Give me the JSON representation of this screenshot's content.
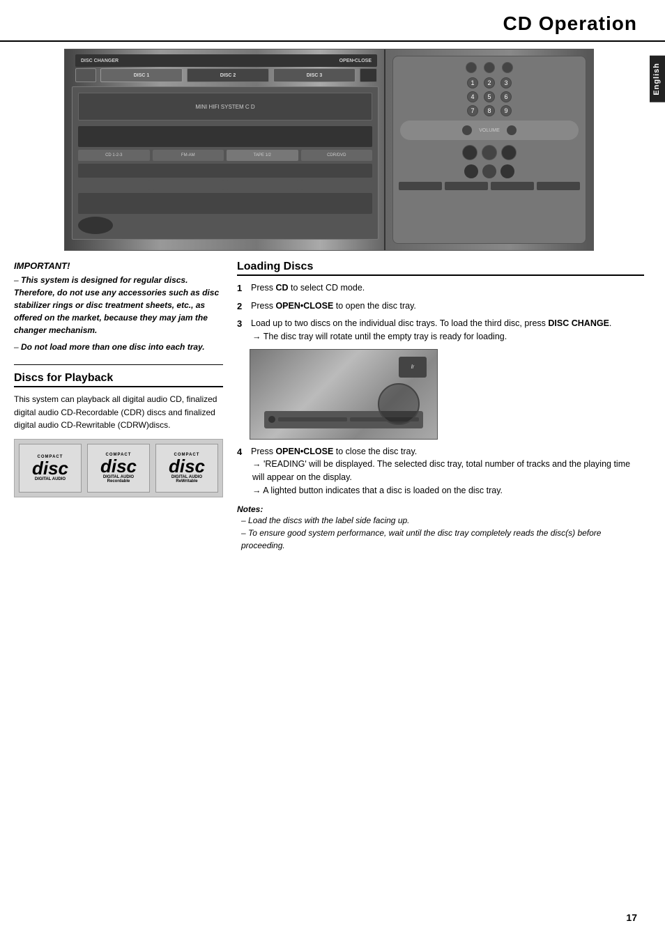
{
  "page": {
    "title": "CD Operation",
    "page_number": "17",
    "language_tab": "English"
  },
  "device_image": {
    "alt": "CD Player and Remote Control device image"
  },
  "important": {
    "title": "IMPORTANT!",
    "text_parts": [
      "This system is designed for regular discs. Therefore, do not use any accessories such as disc stabilizer rings or disc treatment sheets, etc., as offered on the market, because they may jam the changer mechanism.",
      "Do not load more than one disc into each tray."
    ]
  },
  "discs_for_playback": {
    "heading": "Discs for Playback",
    "body": "This system can playback all digital audio CD, finalized digital audio CD-Recordable (CDR) discs and finalized digital audio CD-Rewritable (CDRW)discs.",
    "disc_types": [
      {
        "label_top": "COMPACT",
        "logo": "disc",
        "label_bottom": "DIGITAL AUDIO"
      },
      {
        "label_top": "COMPACT",
        "logo": "disc",
        "label_bottom": "DIGITAL AUDIO\nRecordable"
      },
      {
        "label_top": "COMPACT",
        "logo": "disc",
        "label_bottom": "DIGITAL AUDIO\nReWritable"
      }
    ]
  },
  "loading_discs": {
    "heading": "Loading Discs",
    "steps": [
      {
        "number": "1",
        "text": "Press ",
        "bold": "CD",
        "text2": " to select CD mode."
      },
      {
        "number": "2",
        "text": "Press ",
        "bold": "OPEN•CLOSE",
        "text2": " to open the disc tray."
      },
      {
        "number": "3",
        "text": "Load up to two discs on the individual disc trays. To load the third disc, press ",
        "bold": "DISC CHANGE",
        "text2": ".",
        "arrow": "The disc tray will rotate until the empty tray is ready for loading."
      }
    ],
    "step4": {
      "number": "4",
      "text": "Press ",
      "bold": "OPEN•CLOSE",
      "text2": " to close the disc tray.",
      "arrows": [
        "'READING' will be displayed. The selected disc tray, total number of tracks and the playing time will appear on the display.",
        "A lighted button indicates that a disc is loaded on the disc tray."
      ]
    },
    "cd_tray_image_alt": "CD tray loading image"
  },
  "notes": {
    "title": "Notes:",
    "items": [
      "Load the discs with the label side facing up.",
      "To ensure good system performance, wait until the disc tray completely reads the disc(s) before proceeding."
    ]
  }
}
